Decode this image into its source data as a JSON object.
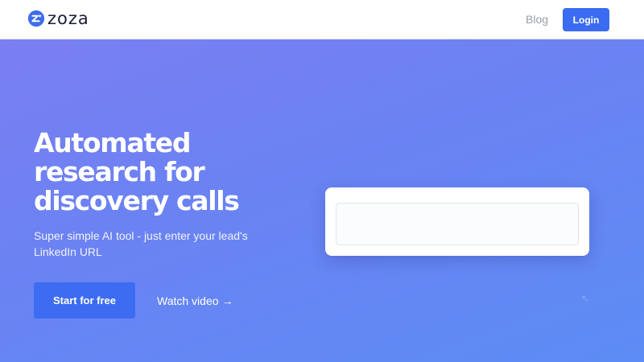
{
  "header": {
    "logo_text": "zoza",
    "nav": {
      "blog_label": "Blog"
    },
    "login_label": "Login"
  },
  "hero": {
    "title_lines": [
      "Automated",
      "research for",
      "discovery calls"
    ],
    "subtitle_lines": [
      "Super simple AI tool - just enter your lead's",
      "LinkedIn URL"
    ]
  },
  "cta": {
    "start_label": "Start for free",
    "watch_label": "Watch video",
    "watch_icon": "arrow-right-icon"
  },
  "search": {
    "value": "",
    "placeholder": ""
  },
  "colors": {
    "accent": "#3b6bf0",
    "gradient_start": "#7d7ef2",
    "gradient_end": "#5c8cf5"
  }
}
